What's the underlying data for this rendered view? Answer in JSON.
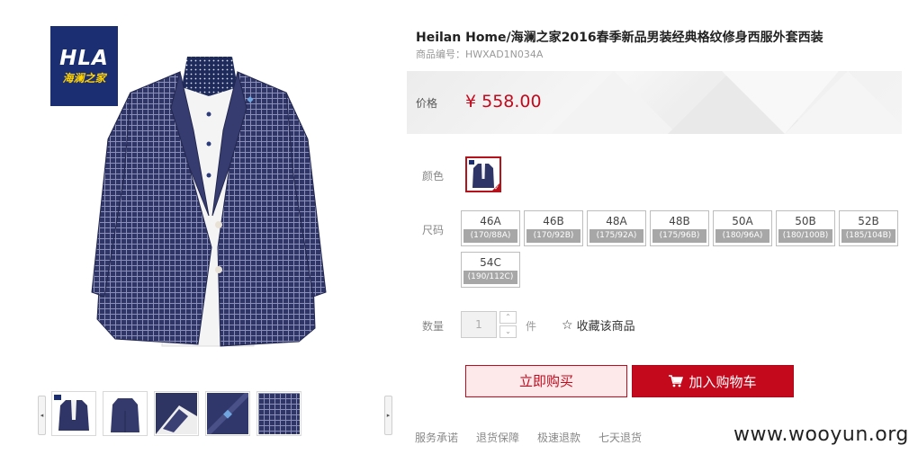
{
  "brand": {
    "logo_text": "HLA",
    "logo_subtext": "海澜之家",
    "logo_bg": "#1b2e72",
    "logo_sub_color": "#ffd200"
  },
  "gallery": {
    "main_image_icon": "navy-check-blazer-image",
    "thumbnails": [
      {
        "icon": "blazer-front-thumb"
      },
      {
        "icon": "blazer-back-thumb"
      },
      {
        "icon": "blazer-lapel-detail-thumb"
      },
      {
        "icon": "blazer-button-detail-thumb"
      },
      {
        "icon": "blazer-fabric-detail-thumb"
      }
    ],
    "prev_arrow": "◂",
    "next_arrow": "▸"
  },
  "product": {
    "title": "Heilan Home/海澜之家2016春季新品男装经典格纹修身西服外套西装",
    "sku": "商品编号：HWXAD1N034A"
  },
  "price": {
    "label": "价格",
    "value": "¥ 558.00",
    "color": "#c4091c"
  },
  "color_option": {
    "label": "颜色",
    "selected_icon": "navy-blazer-swatch",
    "check": "✓"
  },
  "size_option": {
    "label": "尺码",
    "sizes": [
      {
        "size": "46A",
        "fit": "(170/88A)"
      },
      {
        "size": "46B",
        "fit": "(170/92B)"
      },
      {
        "size": "48A",
        "fit": "(175/92A)"
      },
      {
        "size": "48B",
        "fit": "(175/96B)"
      },
      {
        "size": "50A",
        "fit": "(180/96A)"
      },
      {
        "size": "50B",
        "fit": "(180/100B)"
      },
      {
        "size": "52B",
        "fit": "(185/104B)"
      },
      {
        "size": "54C",
        "fit": "(190/112C)"
      }
    ]
  },
  "quantity": {
    "label": "数量",
    "value": "1",
    "unit": "件",
    "up": "⌃",
    "down": "⌄"
  },
  "favorite": {
    "icon": "star-outline-icon",
    "glyph": "☆",
    "label": "收藏该商品"
  },
  "actions": {
    "buy_now": "立即购买",
    "add_to_cart": "加入购物车",
    "accent": "#c4091c"
  },
  "services": [
    "服务承诺",
    "退货保障",
    "极速退款",
    "七天退货"
  ],
  "watermark": "www.wooyun.org"
}
